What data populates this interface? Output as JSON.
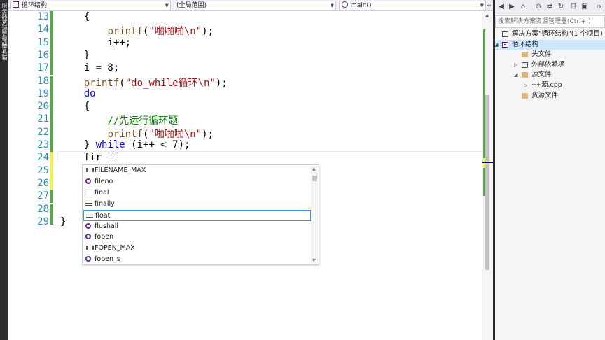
{
  "left_strip": {
    "tabs": [
      "服务器资源管理器",
      "工具箱"
    ]
  },
  "navbar": {
    "project_combo": "循环结构",
    "scope_combo": "(全局范围)",
    "function_combo": "main()"
  },
  "editor": {
    "lines": [
      {
        "num": "13",
        "indent": 4,
        "tokens": [
          [
            "p",
            "{"
          ]
        ]
      },
      {
        "num": "14",
        "indent": 8,
        "tokens": [
          [
            "fn",
            "printf"
          ],
          [
            "p",
            "("
          ],
          [
            "str",
            "\"啪啪啪\\n\""
          ],
          [
            "p",
            ");"
          ]
        ]
      },
      {
        "num": "15",
        "indent": 8,
        "tokens": [
          [
            "p",
            "i++;"
          ]
        ]
      },
      {
        "num": "16",
        "indent": 4,
        "tokens": [
          [
            "p",
            "}"
          ]
        ]
      },
      {
        "num": "17",
        "indent": 4,
        "tokens": [
          [
            "p",
            "i = 8;"
          ]
        ]
      },
      {
        "num": "18",
        "indent": 4,
        "tokens": [
          [
            "fn",
            "printf"
          ],
          [
            "p",
            "("
          ],
          [
            "str",
            "\"do_while循环\\n\""
          ],
          [
            "p",
            ");"
          ]
        ]
      },
      {
        "num": "19",
        "indent": 4,
        "tokens": [
          [
            "kw",
            "do"
          ]
        ]
      },
      {
        "num": "20",
        "indent": 4,
        "tokens": [
          [
            "p",
            "{"
          ]
        ]
      },
      {
        "num": "21",
        "indent": 8,
        "tokens": [
          [
            "cmt",
            "//先运行循环题"
          ]
        ]
      },
      {
        "num": "22",
        "indent": 8,
        "tokens": [
          [
            "fn",
            "printf"
          ],
          [
            "p",
            "("
          ],
          [
            "str",
            "\"啪啪啪\\n\""
          ],
          [
            "p",
            ");"
          ]
        ]
      },
      {
        "num": "23",
        "indent": 4,
        "tokens": [
          [
            "p",
            "} "
          ],
          [
            "kw",
            "while"
          ],
          [
            "p",
            " (i++ < 7);"
          ]
        ]
      },
      {
        "num": "24",
        "indent": 4,
        "tokens": [
          [
            "p",
            "fir"
          ]
        ]
      },
      {
        "num": "25",
        "indent": 0,
        "tokens": []
      },
      {
        "num": "26",
        "indent": 0,
        "tokens": []
      },
      {
        "num": "27",
        "indent": 0,
        "tokens": []
      },
      {
        "num": "28",
        "indent": 0,
        "tokens": []
      },
      {
        "num": "29",
        "indent": 0,
        "tokens": [
          [
            "p",
            "}"
          ]
        ]
      }
    ]
  },
  "completion_list": {
    "items": [
      {
        "label": "FILENAME_MAX",
        "kind": "macro-icon"
      },
      {
        "label": "fileno",
        "kind": "function-icon"
      },
      {
        "label": "final",
        "kind": "keyword-icon"
      },
      {
        "label": "finally",
        "kind": "keyword-icon"
      },
      {
        "label": "float",
        "kind": "keyword-icon",
        "selected": true
      },
      {
        "label": "flushall",
        "kind": "function-icon"
      },
      {
        "label": "fopen",
        "kind": "function-icon"
      },
      {
        "label": "FOPEN_MAX",
        "kind": "macro-icon"
      },
      {
        "label": "fopen_s",
        "kind": "function-icon"
      }
    ]
  },
  "solution_explorer": {
    "search_placeholder": "搜索解决方案资源管理器(Ctrl+;)",
    "tree": [
      {
        "label": "解决方案\"循环结构\"(1 个项目)",
        "icon": "solution-icon",
        "level": 0
      },
      {
        "label": "循环结构",
        "icon": "project-icon",
        "level": 0,
        "expanded": true,
        "selected": true
      },
      {
        "label": "头文件",
        "icon": "folder-icon",
        "level": 2
      },
      {
        "label": "外部依赖项",
        "icon": "references-icon",
        "level": 2,
        "collapsed": true
      },
      {
        "label": "源文件",
        "icon": "folder-icon",
        "level": 2,
        "expanded": true
      },
      {
        "label": "源.cpp",
        "icon": "cpp-file-icon",
        "level": 3,
        "collapsed": true
      },
      {
        "label": "资源文件",
        "icon": "folder-icon",
        "level": 2
      }
    ]
  },
  "colors": {
    "keyword": "#0000ff",
    "function": "#74531f",
    "string": "#a31515",
    "comment": "#008000",
    "line_number": "#2b91af",
    "saved_change": "#57a64a",
    "unsaved_change": "#efef50",
    "selection_border": "#3399ff"
  }
}
